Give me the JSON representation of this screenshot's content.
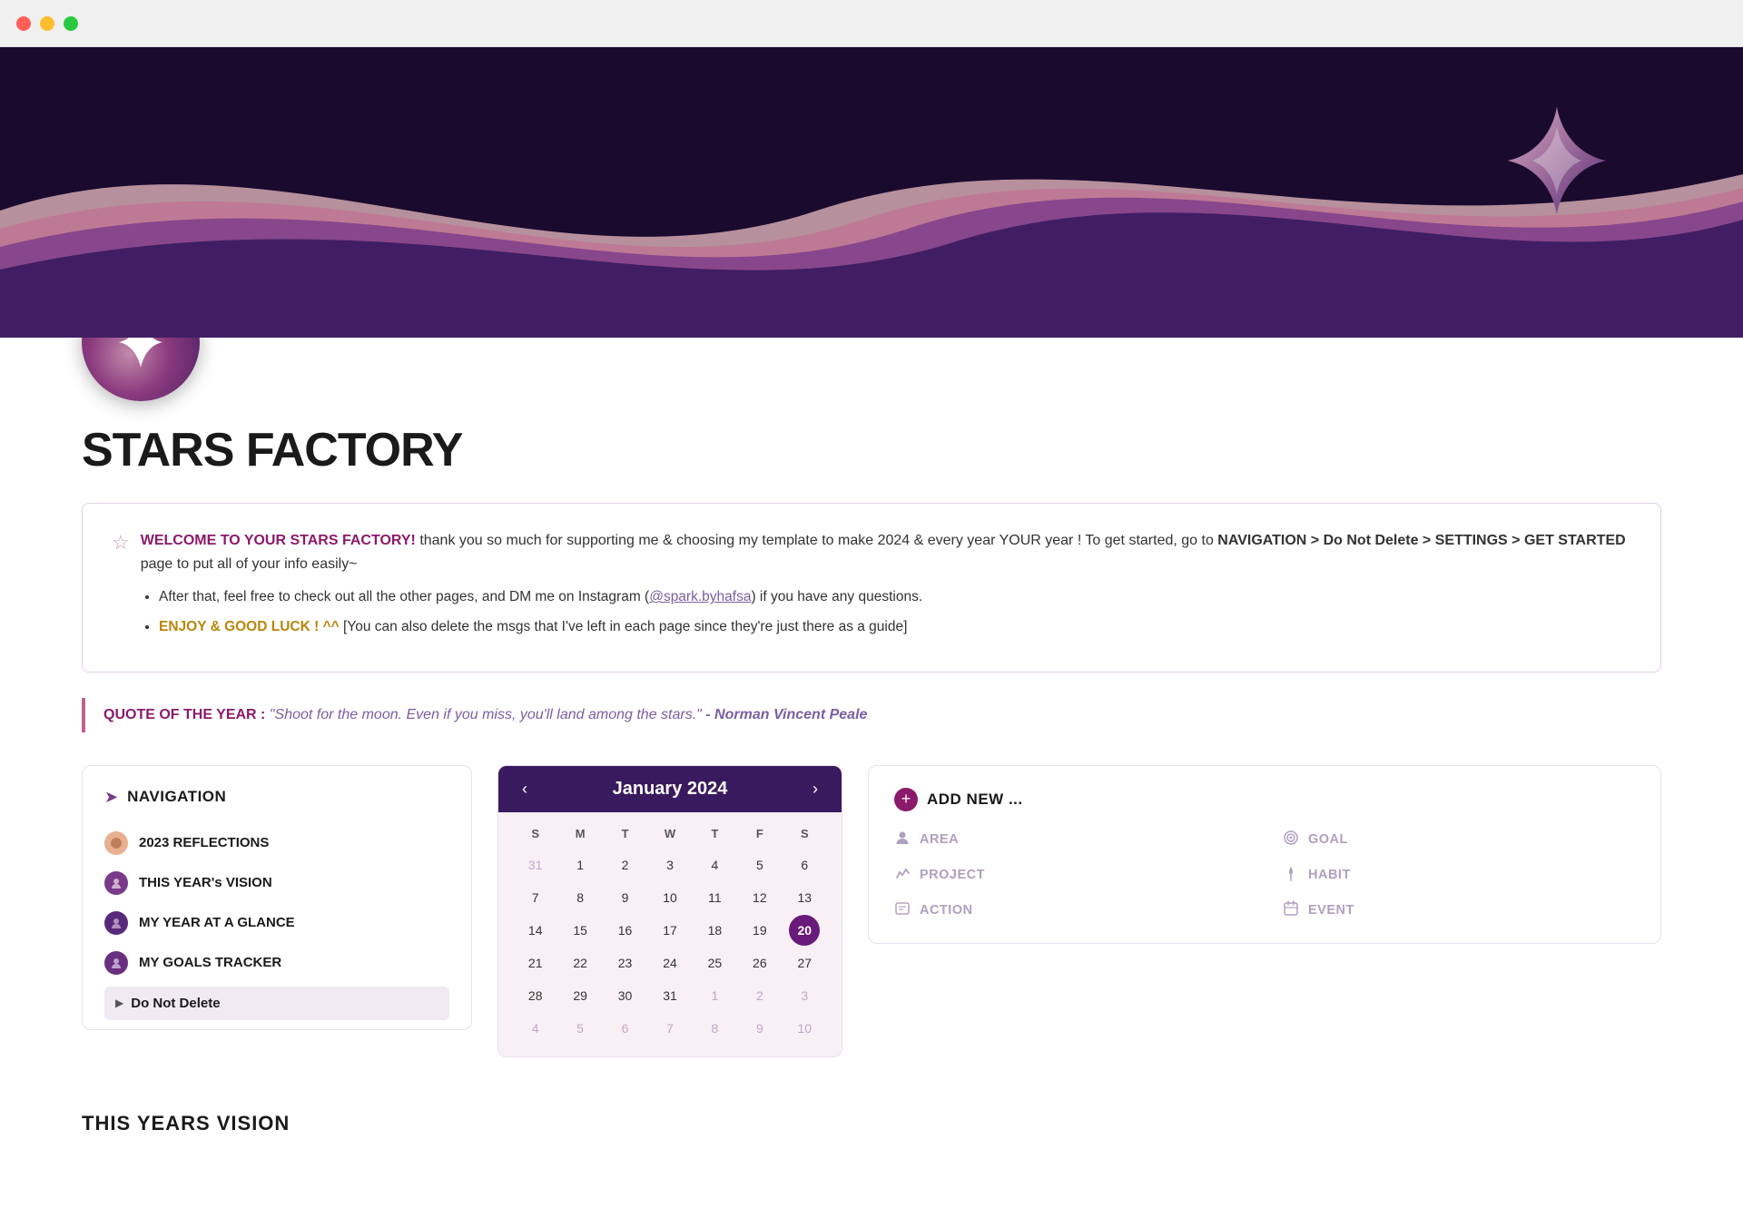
{
  "window": {
    "title": "STARS FACTORY"
  },
  "header": {
    "title": "STARS FACTORY"
  },
  "welcome": {
    "bold_start": "WELCOME TO YOUR STARS FACTORY!",
    "text_1": " thank you so much for supporting me & choosing my template to make 2024 & every year YOUR year !  To get started, go to ",
    "nav_path": "NAVIGATION > Do Not Delete > SETTINGS > GET STARTED",
    "text_2": " page to put all of your info easily~",
    "bullet_1": "After that, feel free to check out all the other pages, and DM me on Instagram (",
    "instagram": "@spark.byhafsa",
    "bullet_1_end": ") if you have any questions.",
    "bullet_2_start": "ENJOY & GOOD LUCK ! ^^",
    "bullet_2_end": " [You can also delete the msgs that I've left in each page since they're just there as a guide]"
  },
  "quote": {
    "label": "QUOTE OF THE YEAR :",
    "text": "\"Shoot for the moon. Even if you miss, you'll land among the stars.\"",
    "author": "- Norman Vincent Peale"
  },
  "navigation": {
    "title": "NAVIGATION",
    "items": [
      {
        "label": "2023 REFLECTIONS",
        "icon_type": "peach"
      },
      {
        "label": "THIS YEAR's VISION",
        "icon_type": "purple"
      },
      {
        "label": "MY YEAR AT A GLANCE",
        "icon_type": "darkpurple"
      },
      {
        "label": "MY GOALS TRACKER",
        "icon_type": "midpurple"
      }
    ],
    "do_not_delete": "Do Not Delete"
  },
  "calendar": {
    "month": "January 2024",
    "day_names": [
      "S",
      "M",
      "T",
      "W",
      "T",
      "F",
      "S"
    ],
    "weeks": [
      [
        "31",
        "1",
        "2",
        "3",
        "4",
        "5",
        "6"
      ],
      [
        "7",
        "8",
        "9",
        "10",
        "11",
        "12",
        "13"
      ],
      [
        "14",
        "15",
        "16",
        "17",
        "18",
        "19",
        "20"
      ],
      [
        "21",
        "22",
        "23",
        "24",
        "25",
        "26",
        "27"
      ],
      [
        "28",
        "29",
        "30",
        "31",
        "1",
        "2",
        "3"
      ],
      [
        "4",
        "5",
        "6",
        "7",
        "8",
        "9",
        "10"
      ]
    ],
    "other_month_start": [
      "31"
    ],
    "other_month_end_w5": [
      "1",
      "2",
      "3"
    ],
    "other_month_end_w6": [
      "4",
      "5",
      "6",
      "7",
      "8",
      "9",
      "10"
    ],
    "today": "20"
  },
  "add_new": {
    "title": "ADD NEW ...",
    "items": [
      {
        "label": "AREA",
        "icon": "person"
      },
      {
        "label": "GOAL",
        "icon": "target"
      },
      {
        "label": "PROJECT",
        "icon": "wrench"
      },
      {
        "label": "HABIT",
        "icon": "flame"
      },
      {
        "label": "ACTION",
        "icon": "note"
      },
      {
        "label": "EVENT",
        "icon": "grid"
      }
    ]
  },
  "vision": {
    "title": "THIS YEARs VISION"
  },
  "colors": {
    "accent_purple": "#8b1a6b",
    "dark_purple": "#3a1a5e",
    "mid_purple": "#7a3a8a",
    "light_purple_bg": "#f9f0f5",
    "quote_color": "#7a5fa0",
    "nav_bg": "#f0eaf5"
  }
}
